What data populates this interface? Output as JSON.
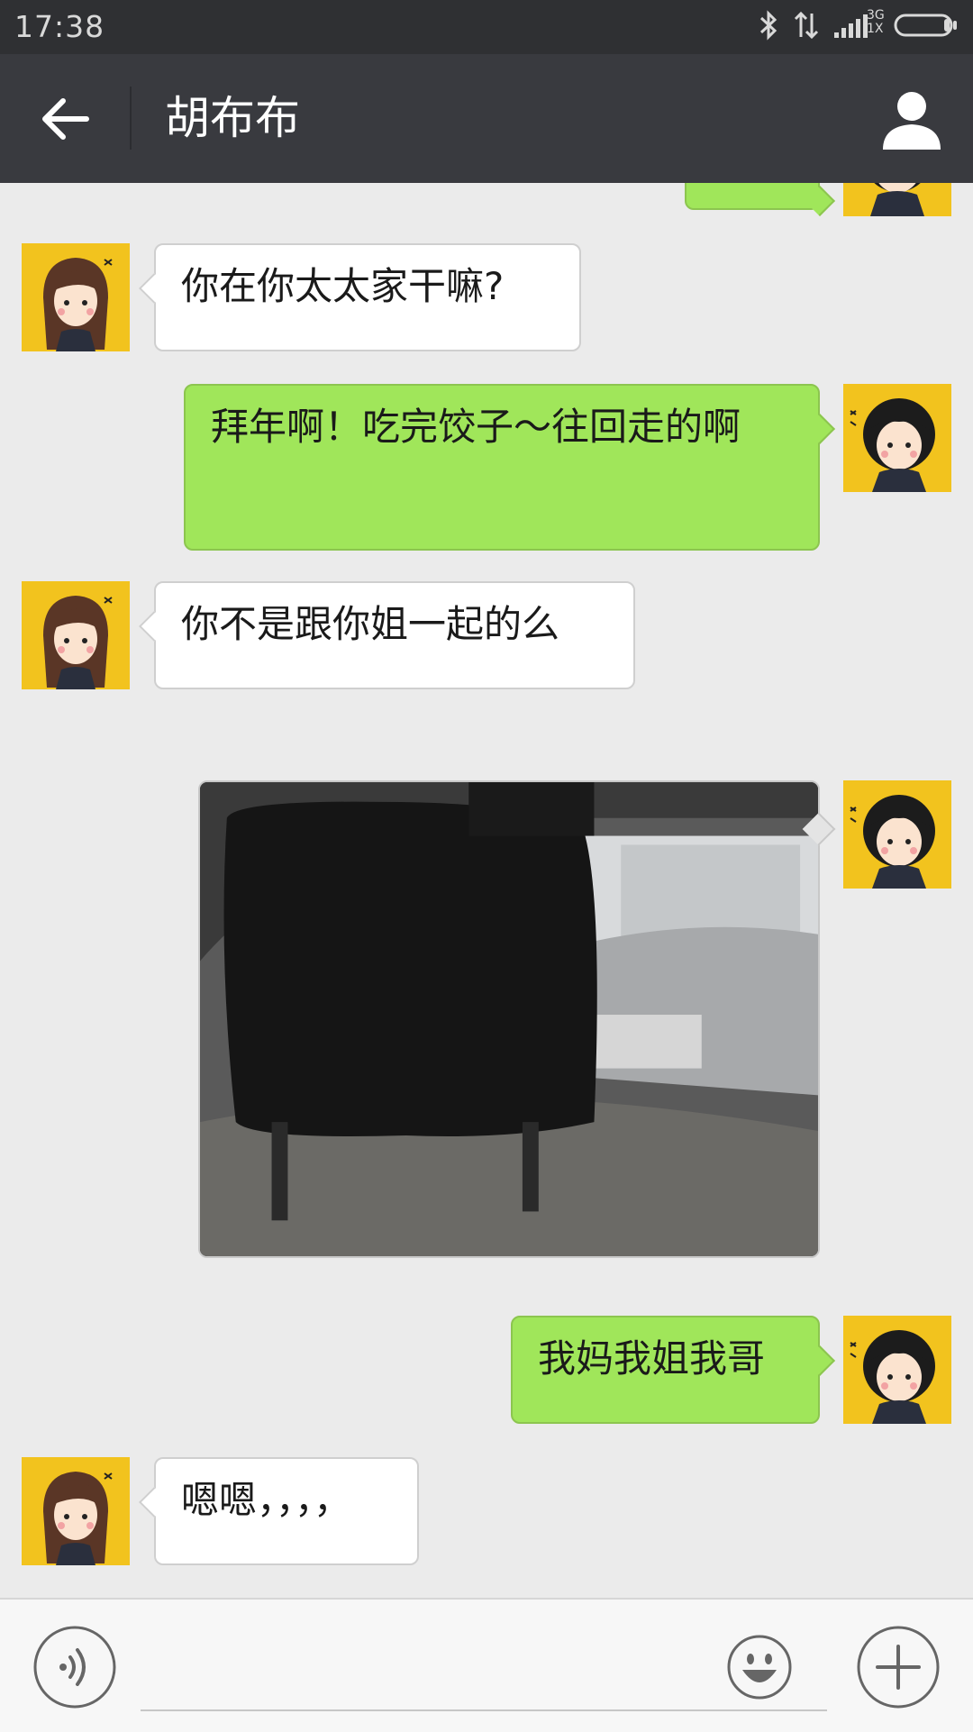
{
  "status_bar": {
    "time": "17:38",
    "network_top": "3G",
    "network_bottom": "1X",
    "icons": [
      "bluetooth-icon",
      "data-transfer-icon",
      "signal-icon",
      "battery-icon"
    ]
  },
  "header": {
    "title": "胡布布",
    "back_icon": "arrow-left-icon",
    "contact_icon": "person-icon"
  },
  "messages": [
    {
      "sender": "contact",
      "text": "你在你太太家干嘛?"
    },
    {
      "sender": "me",
      "text": "拜年啊！吃完饺子～往回走的啊"
    },
    {
      "sender": "contact",
      "text": "你不是跟你姐一起的么"
    },
    {
      "sender": "me",
      "type": "photo",
      "description": ""
    },
    {
      "sender": "me",
      "text": "我妈我姐我哥"
    },
    {
      "sender": "contact",
      "text": "嗯嗯，，，，"
    }
  ],
  "input_bar": {
    "voice_icon": "voice-icon",
    "emoji_icon": "emoji-icon",
    "plus_icon": "plus-icon",
    "placeholder": ""
  },
  "colors": {
    "status_bar": "#2f3033",
    "header": "#393a3f",
    "chat_bg": "#ebebeb",
    "bubble_out": "#a0e65a",
    "bubble_in": "#ffffff",
    "avatar_bg": "#f2c31e"
  }
}
